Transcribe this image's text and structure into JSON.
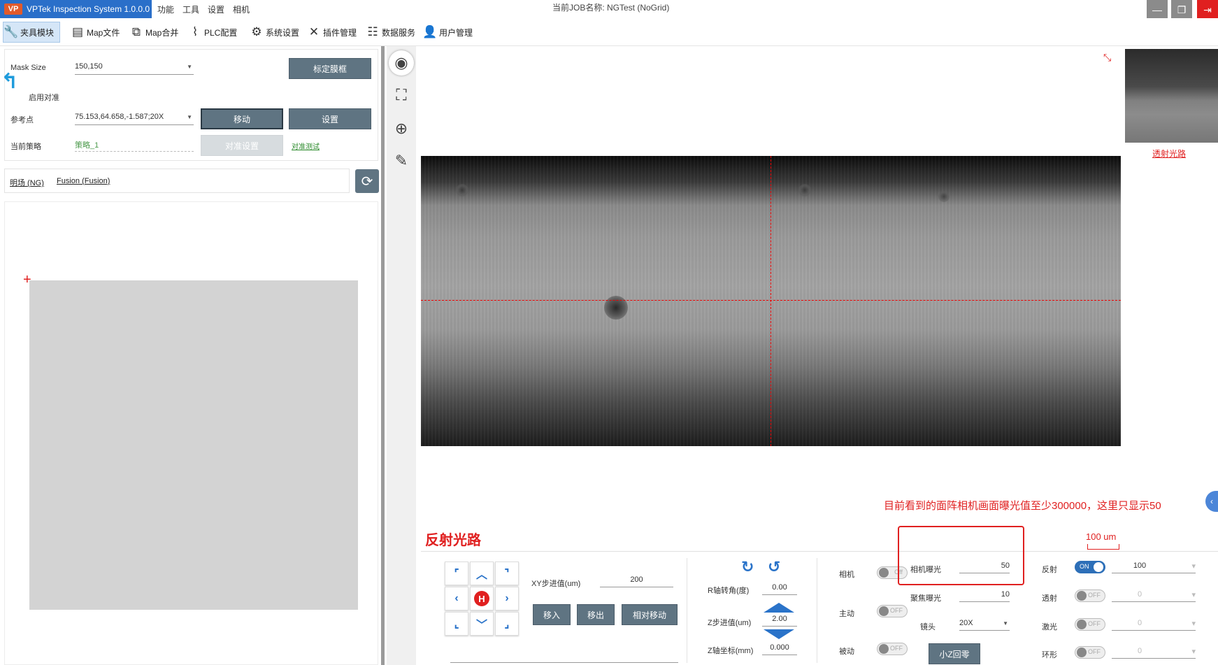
{
  "app": {
    "logo": "VP",
    "title": "VPTek Inspection System 1.0.0.0",
    "menus": [
      "功能",
      "工具",
      "设置",
      "相机"
    ],
    "job_title": "当前JOB名称: NGTest (NoGrid)"
  },
  "toolbar": {
    "items": [
      {
        "label": "夹具模块",
        "icon": "wrench-icon"
      },
      {
        "label": "Map文件",
        "icon": "document-icon"
      },
      {
        "label": "Map合并",
        "icon": "merge-icon"
      },
      {
        "label": "PLC配置",
        "icon": "plc-icon"
      },
      {
        "label": "系统设置",
        "icon": "gear-icon"
      },
      {
        "label": "插件管理",
        "icon": "tools-icon"
      },
      {
        "label": "数据服务",
        "icon": "database-icon"
      },
      {
        "label": "用户管理",
        "icon": "user-icon"
      }
    ]
  },
  "left_panel": {
    "mask_size_label": "Mask Size",
    "mask_size_value": "150,150",
    "calibrate_button": "标定膜框",
    "use_align_label": "启用对准",
    "ref_point_label": "参考点",
    "ref_point_value": "75.153,64.658,-1.587;20X",
    "move_button": "移动",
    "set_button": "设置",
    "strategy_label": "当前策略",
    "strategy_value": "策略_1",
    "align_settings_button": "对准设置",
    "align_test_link": "对准测试",
    "mode_links": [
      "明场 (NG)",
      "Fusion (Fusion)"
    ]
  },
  "camera_view": {
    "thumb_label": "透射光路",
    "annotation": "目前看到的面阵相机画面曝光值至少300000，这里只显示50",
    "path_label": "反射光路",
    "scale_label": "100 um"
  },
  "controls": {
    "xy_step_label": "XY步进值(um)",
    "xy_step_value": "200",
    "move_in_button": "移入",
    "move_out_button": "移出",
    "relative_move_button": "相对移动",
    "r_angle_label": "R轴转角(度)",
    "r_angle_value": "0.00",
    "z_step_label": "Z步进值(um)",
    "z_step_value": "2.00",
    "z_coord_label": "Z轴坐标(mm)",
    "z_coord_value": "0.000",
    "camera_label": "相机",
    "camera_toggle": "Off",
    "active_label": "主动",
    "active_toggle": "OFF",
    "passive_label": "被动",
    "passive_toggle": "OFF",
    "exposure_label": "相机曝光",
    "exposure_value": "50",
    "focus_exposure_label": "聚焦曝光",
    "focus_exposure_value": "10",
    "lens_label": "镜头",
    "lens_value": "20X",
    "small_z_home_button": "小Z回零",
    "lights": [
      {
        "label": "反射",
        "toggle": "ON",
        "value": "100"
      },
      {
        "label": "透射",
        "toggle": "OFF",
        "value": "0"
      },
      {
        "label": "激光",
        "toggle": "OFF",
        "value": "0"
      },
      {
        "label": "环形",
        "toggle": "OFF",
        "value": "0"
      }
    ]
  },
  "colors": {
    "accent_blue": "#2a6fc9",
    "button_gray": "#5f7482",
    "annotation_red": "#e02020"
  }
}
